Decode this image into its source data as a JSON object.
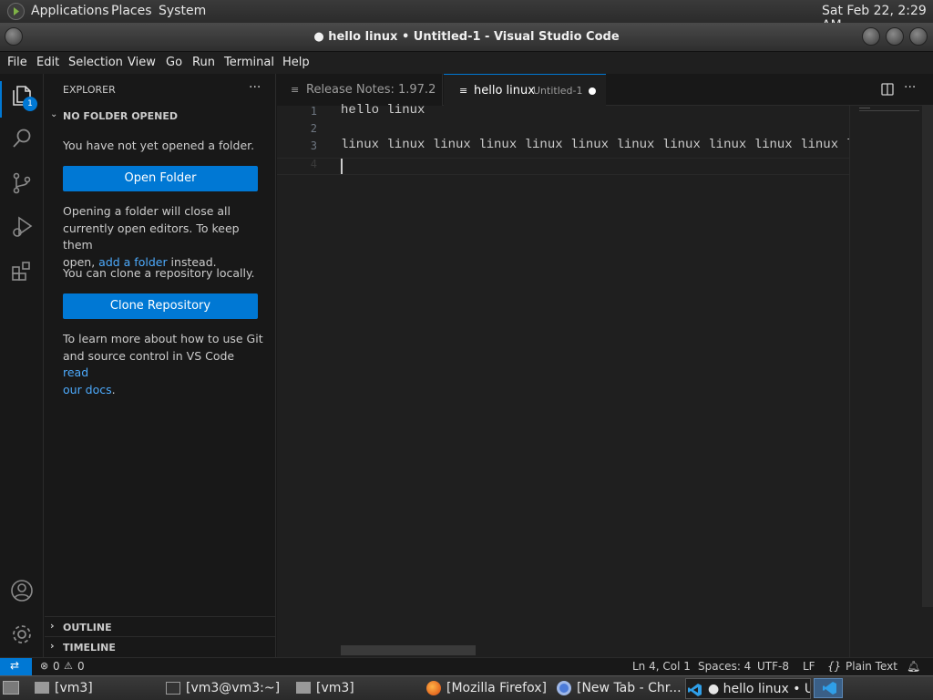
{
  "topbar": {
    "menus": [
      "Applications",
      "Places",
      "System"
    ],
    "clock": "Sat Feb 22,  2:29 AM"
  },
  "window": {
    "title": "● hello linux • Untitled-1 - Visual Studio Code"
  },
  "menubar": [
    "File",
    "Edit",
    "Selection",
    "View",
    "Go",
    "Run",
    "Terminal",
    "Help"
  ],
  "activity": {
    "explorer_badge": "1"
  },
  "sidebar": {
    "header": "EXPLORER",
    "more": "···",
    "section_title": "NO FOLDER OPENED",
    "no_folder_msg": "You have not yet opened a folder.",
    "open_folder_btn": "Open Folder",
    "opening_msg_1": "Opening a folder will close all",
    "opening_msg_2": "currently open editors. To keep them",
    "opening_msg_3_pre": "open, ",
    "opening_msg_link": "add a folder",
    "opening_msg_3_post": " instead.",
    "clone_msg": "You can clone a repository locally.",
    "clone_btn": "Clone Repository",
    "git_msg_1": "To learn more about how to use Git",
    "git_msg_2_pre": "and source control in VS Code ",
    "git_msg_link_1": "read",
    "git_msg_link_2": "our docs",
    "git_msg_end": ".",
    "outline": "OUTLINE",
    "timeline": "TIMELINE"
  },
  "tabs": [
    {
      "label": "Release Notes: 1.97.2",
      "active": false
    },
    {
      "label": "hello linux",
      "sublabel": "Untitled-1",
      "active": true,
      "dirty": true
    }
  ],
  "editor": {
    "line_numbers": [
      "1",
      "2",
      "3",
      "4"
    ],
    "lines": [
      "hello linux",
      "",
      "linux linux linux linux linux linux linux linux linux linux linux l",
      ""
    ]
  },
  "status": {
    "errors": "0",
    "warnings": "0",
    "position": "Ln 4, Col 1",
    "spaces": "Spaces: 4",
    "encoding": "UTF-8",
    "eol": "LF",
    "language": "Plain Text"
  },
  "taskbar": {
    "items": [
      "[vm3]",
      "[vm3@vm3:~]",
      "[vm3]",
      "[Mozilla Firefox]",
      "[New Tab - Chr...",
      "● hello linux • U..."
    ]
  },
  "colors": {
    "accent": "#0078d4",
    "link": "#4daafc",
    "background": "#181818",
    "editor_bg": "#1f1f1f"
  }
}
